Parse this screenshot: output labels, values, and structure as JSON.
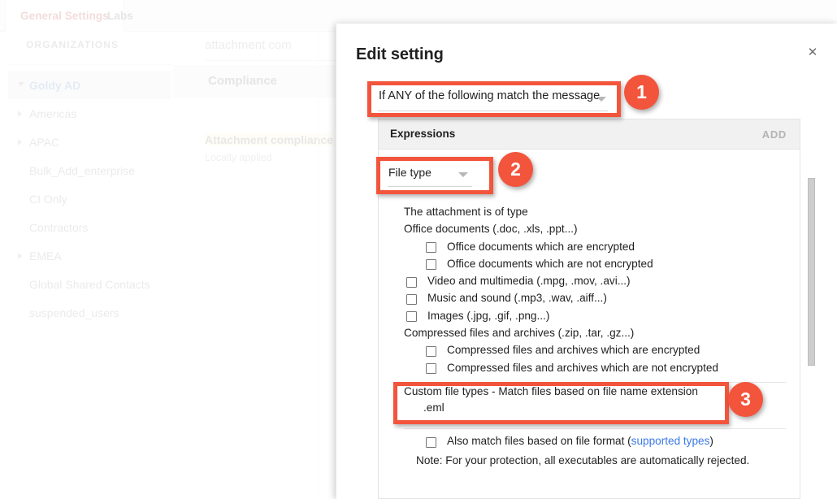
{
  "background": {
    "tabs": [
      {
        "label": "General Settings",
        "active": true
      },
      {
        "label": "Labs",
        "active": false
      }
    ],
    "organizations_header": "ORGANIZATIONS",
    "search_value": "attachment com",
    "compliance_label": "Compliance",
    "org_items": [
      {
        "label": "Goldy AD",
        "selected": true,
        "expanded": true,
        "has_caret": true,
        "indent": 0
      },
      {
        "label": "Americas",
        "selected": false,
        "expanded": false,
        "has_caret": true,
        "indent": 1
      },
      {
        "label": "APAC",
        "selected": false,
        "expanded": false,
        "has_caret": true,
        "indent": 1
      },
      {
        "label": "Bulk_Add_enterprise",
        "selected": false,
        "expanded": false,
        "has_caret": false,
        "indent": 1
      },
      {
        "label": "CI Only",
        "selected": false,
        "expanded": false,
        "has_caret": false,
        "indent": 1
      },
      {
        "label": "Contractors",
        "selected": false,
        "expanded": false,
        "has_caret": false,
        "indent": 1
      },
      {
        "label": "EMEA",
        "selected": false,
        "expanded": false,
        "has_caret": true,
        "indent": 1
      },
      {
        "label": "Global Shared Contacts",
        "selected": false,
        "expanded": false,
        "has_caret": false,
        "indent": 1
      },
      {
        "label": "suspended_users",
        "selected": false,
        "expanded": false,
        "has_caret": false,
        "indent": 1
      }
    ],
    "setting_title": "Attachment compliance",
    "setting_subtitle": "Locally applied"
  },
  "dialog": {
    "title": "Edit setting",
    "close_icon": "close-icon",
    "condition_select": {
      "value": "If ANY of the following match the message",
      "icon": "chevron-down-icon"
    },
    "expressions": {
      "header": "Expressions",
      "add_label": "ADD"
    },
    "type_select": {
      "value": "File type",
      "icon": "chevron-down-icon"
    },
    "intro_text": "The attachment is of type",
    "rows": [
      {
        "label": "Office documents (.doc, .xls, .ppt...)",
        "checkbox": false,
        "level": 0,
        "checked": false
      },
      {
        "label": "Office documents which are encrypted",
        "checkbox": true,
        "level": 1,
        "checked": false
      },
      {
        "label": "Office documents which are not encrypted",
        "checkbox": true,
        "level": 1,
        "checked": false
      },
      {
        "label": "Video and multimedia (.mpg, .mov, .avi...)",
        "checkbox": true,
        "level": 0,
        "checked": false
      },
      {
        "label": "Music and sound (.mp3, .wav, .aiff...)",
        "checkbox": true,
        "level": 0,
        "checked": false
      },
      {
        "label": "Images (.jpg, .gif, .png...)",
        "checkbox": true,
        "level": 0,
        "checked": false
      },
      {
        "label": "Compressed files and archives (.zip, .tar, .gz...)",
        "checkbox": false,
        "level": 0,
        "checked": false
      },
      {
        "label": "Compressed files and archives which are encrypted",
        "checkbox": true,
        "level": 1,
        "checked": false
      },
      {
        "label": "Compressed files and archives which are not encrypted",
        "checkbox": true,
        "level": 1,
        "checked": false
      }
    ],
    "custom_types": {
      "header": "Custom file types - Match files based on file name extension",
      "value": ".eml"
    },
    "also_match": {
      "prefix": "Also match files based on file format (",
      "link": "supported types",
      "suffix": ")",
      "checked": false
    },
    "note": "Note: For your protection, all executables are automatically rejected."
  },
  "annotations": {
    "accent_color": "#F3543C",
    "badges": [
      {
        "number": "1"
      },
      {
        "number": "2"
      },
      {
        "number": "3"
      }
    ]
  }
}
